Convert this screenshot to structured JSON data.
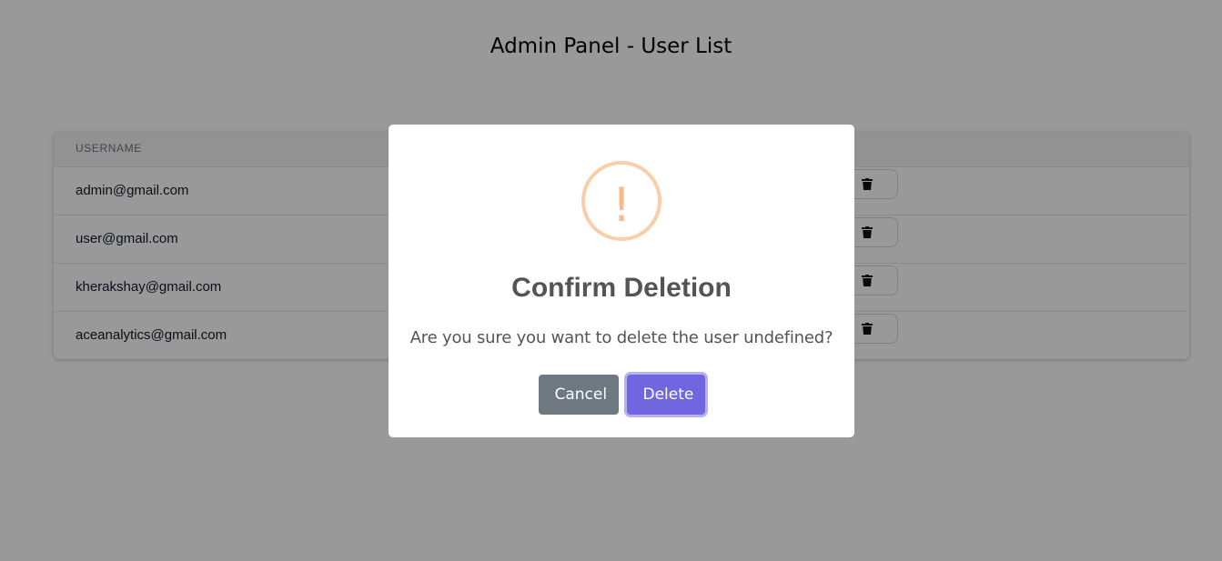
{
  "page": {
    "title": "Admin Panel - User List"
  },
  "table": {
    "columns": [
      "USERNAME"
    ],
    "rows": [
      {
        "username": "admin@gmail.com"
      },
      {
        "username": "user@gmail.com"
      },
      {
        "username": "kherakshay@gmail.com"
      },
      {
        "username": "aceanalytics@gmail.com"
      }
    ],
    "row_action_icon": "trash-icon"
  },
  "modal": {
    "icon": "warning-icon",
    "icon_glyph": "!",
    "icon_color": "#f8bb86",
    "title": "Confirm Deletion",
    "message": "Are you sure you want to delete the user undefined?",
    "cancel_label": "Cancel",
    "confirm_label": "Delete"
  },
  "colors": {
    "cancel_button": "#6e7881",
    "confirm_button": "#7066e0",
    "overlay": "rgba(0,0,0,0.4)"
  }
}
